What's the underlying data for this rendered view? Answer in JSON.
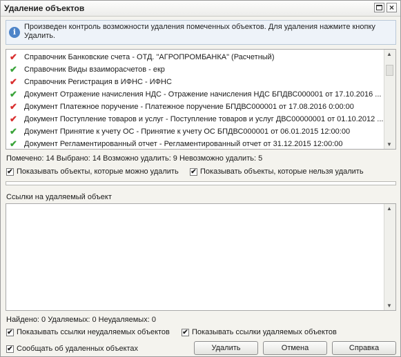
{
  "window": {
    "title": "Удаление объектов"
  },
  "info": {
    "icon": "info-icon",
    "text": "Произведен контроль возможности удаления помеченных объектов. Для удаления нажмите кнопку Удалить."
  },
  "objects": [
    {
      "status": "cannot",
      "text": "Справочник Банковские счета - ОТД. \"АГРОПРОМБАНКА\" (Расчетный)"
    },
    {
      "status": "can",
      "text": "Справочник Виды взаиморасчетов - екр"
    },
    {
      "status": "cannot",
      "text": "Справочник Регистрация в ИФНС - ИФНС"
    },
    {
      "status": "can",
      "text": "Документ Отражение начисления НДС - Отражение начисления НДС БПДВС000001 от 17.10.2016 ..."
    },
    {
      "status": "cannot",
      "text": "Документ Платежное поручение - Платежное поручение БПДВС000001 от 17.08.2016 0:00:00"
    },
    {
      "status": "cannot",
      "text": "Документ Поступление товаров и услуг - Поступление товаров и услуг ДВС00000001 от 01.10.2012 ..."
    },
    {
      "status": "can",
      "text": "Документ Принятие к учету ОС - Принятие к учету ОС БПДВС000001 от 06.01.2015 12:00:00"
    },
    {
      "status": "can",
      "text": "Документ Регламентированный отчет - Регламентированный отчет от 31.12.2015 12:00:00"
    }
  ],
  "stats": {
    "text": "Помечено: 14  Выбрано: 14  Возможно удалить: 9  Невозможно удалить: 5"
  },
  "options": {
    "show_can": {
      "label": "Показывать объекты, которые можно удалить",
      "checked": true
    },
    "show_cannot": {
      "label": "Показывать объекты, которые нельзя удалить",
      "checked": true
    }
  },
  "refs": {
    "label": "Ссылки на удаляемый объект"
  },
  "found": {
    "text": "Найдено: 0  Удаляемых: 0  Неудаляемых: 0"
  },
  "ref_options": {
    "show_non_deletable": {
      "label": "Показывать ссылки неудаляемых объектов",
      "checked": true
    },
    "show_deletable": {
      "label": "Показывать ссылки удаляемых объектов",
      "checked": true
    },
    "report_deleted": {
      "label": "Сообщать об удаленных объектах",
      "checked": true
    }
  },
  "buttons": {
    "delete": "Удалить",
    "cancel": "Отмена",
    "help": "Справка"
  },
  "glyphs": {
    "check": "✔",
    "close": "×",
    "up": "▲",
    "down": "▼"
  }
}
